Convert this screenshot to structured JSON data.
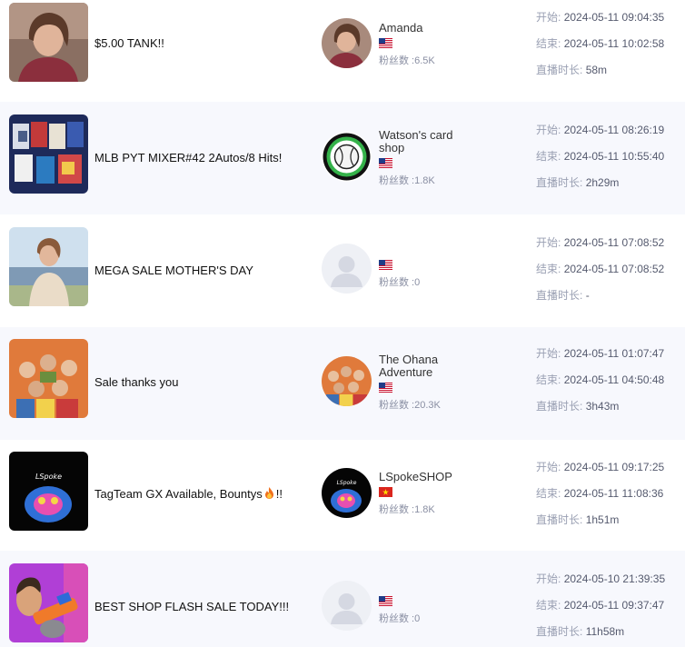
{
  "labels": {
    "start": "开始:",
    "end": "结束:",
    "duration": "直播时长:",
    "fans": "粉丝数 :"
  },
  "colors": {
    "alt_row_bg": "#f7f8fd",
    "label_gray": "#9aa0b3",
    "value_gray": "#555a6e"
  },
  "rows": [
    {
      "title": "$5.00 TANK!!",
      "shop_name": "Amanda",
      "flag": "us-flag-icon",
      "fans": "6.5K",
      "start": "2024-05-11 09:04:35",
      "end": "2024-05-11 10:02:58",
      "duration": "58m"
    },
    {
      "title": "MLB PYT MIXER#42 2Autos/8 Hits!",
      "shop_name": "Watson's card shop",
      "flag": "us-flag-icon",
      "fans": "1.8K",
      "start": "2024-05-11 08:26:19",
      "end": "2024-05-11 10:55:40",
      "duration": "2h29m"
    },
    {
      "title": "MEGA SALE MOTHER'S DAY",
      "shop_name": "",
      "flag": "us-flag-icon",
      "fans": "0",
      "start": "2024-05-11 07:08:52",
      "end": "2024-05-11 07:08:52",
      "duration": "-"
    },
    {
      "title": "Sale thanks you",
      "shop_name": "The Ohana Adventure",
      "flag": "us-flag-icon",
      "fans": "20.3K",
      "start": "2024-05-11 01:07:47",
      "end": "2024-05-11 04:50:48",
      "duration": "3h43m"
    },
    {
      "title": "TagTeam GX Available, Bountys",
      "title_suffix": "!!",
      "shop_name": "LSpokeSHOP",
      "flag": "vn-flag-icon",
      "fans": "1.8K",
      "start": "2024-05-11 09:17:25",
      "end": "2024-05-11 11:08:36",
      "duration": "1h51m"
    },
    {
      "title": "BEST SHOP FLASH SALE TODAY!!!",
      "shop_name": "",
      "flag": "us-flag-icon",
      "fans": "0",
      "start": "2024-05-10 21:39:35",
      "end": "2024-05-11 09:37:47",
      "duration": "11h58m"
    }
  ]
}
